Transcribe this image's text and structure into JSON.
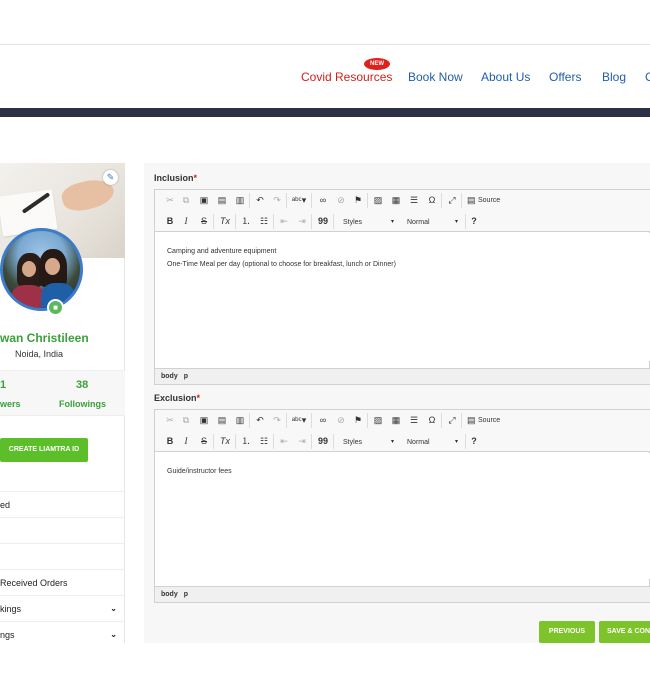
{
  "nav": {
    "badge": "NEW",
    "items": [
      "Covid Resources",
      "Book Now",
      "About Us",
      "Offers",
      "Blog",
      "C"
    ]
  },
  "profile": {
    "name": "wan Christileen",
    "location": "Noida, India",
    "stats": [
      {
        "value": "1",
        "label": "wers"
      },
      {
        "value": "38",
        "label": "Followings"
      }
    ],
    "create_button": "CREATE LIAMTRA ID"
  },
  "side_menu": [
    {
      "label": "ed",
      "has_chevron": false
    },
    {
      "label": "",
      "has_chevron": false
    },
    {
      "label": "",
      "has_chevron": false
    },
    {
      "label": "Received Orders",
      "has_chevron": false
    },
    {
      "label": "kings",
      "has_chevron": true
    },
    {
      "label": "ngs",
      "has_chevron": true
    }
  ],
  "editor_toolbar": {
    "source_label": "Source",
    "styles_label": "Styles",
    "format_label": "Normal",
    "bold": "B",
    "italic": "I",
    "strike": "S",
    "remove_format": "Tx",
    "quote": "99",
    "omega": "Ω",
    "help": "?"
  },
  "inclusion": {
    "label": "Inclusion",
    "required_mark": "*",
    "lines": [
      "Camping and adventure equipment",
      "One-Time Meal per day (optional to choose for breakfast, lunch or Dinner)"
    ],
    "path": [
      "body",
      "p"
    ]
  },
  "exclusion": {
    "label": "Exclusion",
    "required_mark": "*",
    "lines": [
      "Guide/instructor fees"
    ],
    "path": [
      "body",
      "p"
    ]
  },
  "buttons": {
    "previous": "PREVIOUS",
    "save": "SAVE & CONTINUE"
  },
  "colors": {
    "nav_link": "#1f5fa8",
    "nav_covid": "#d0211c",
    "dark_bar": "#2c3148",
    "green": "#5cbf2a",
    "name_green": "#3ba03b"
  }
}
